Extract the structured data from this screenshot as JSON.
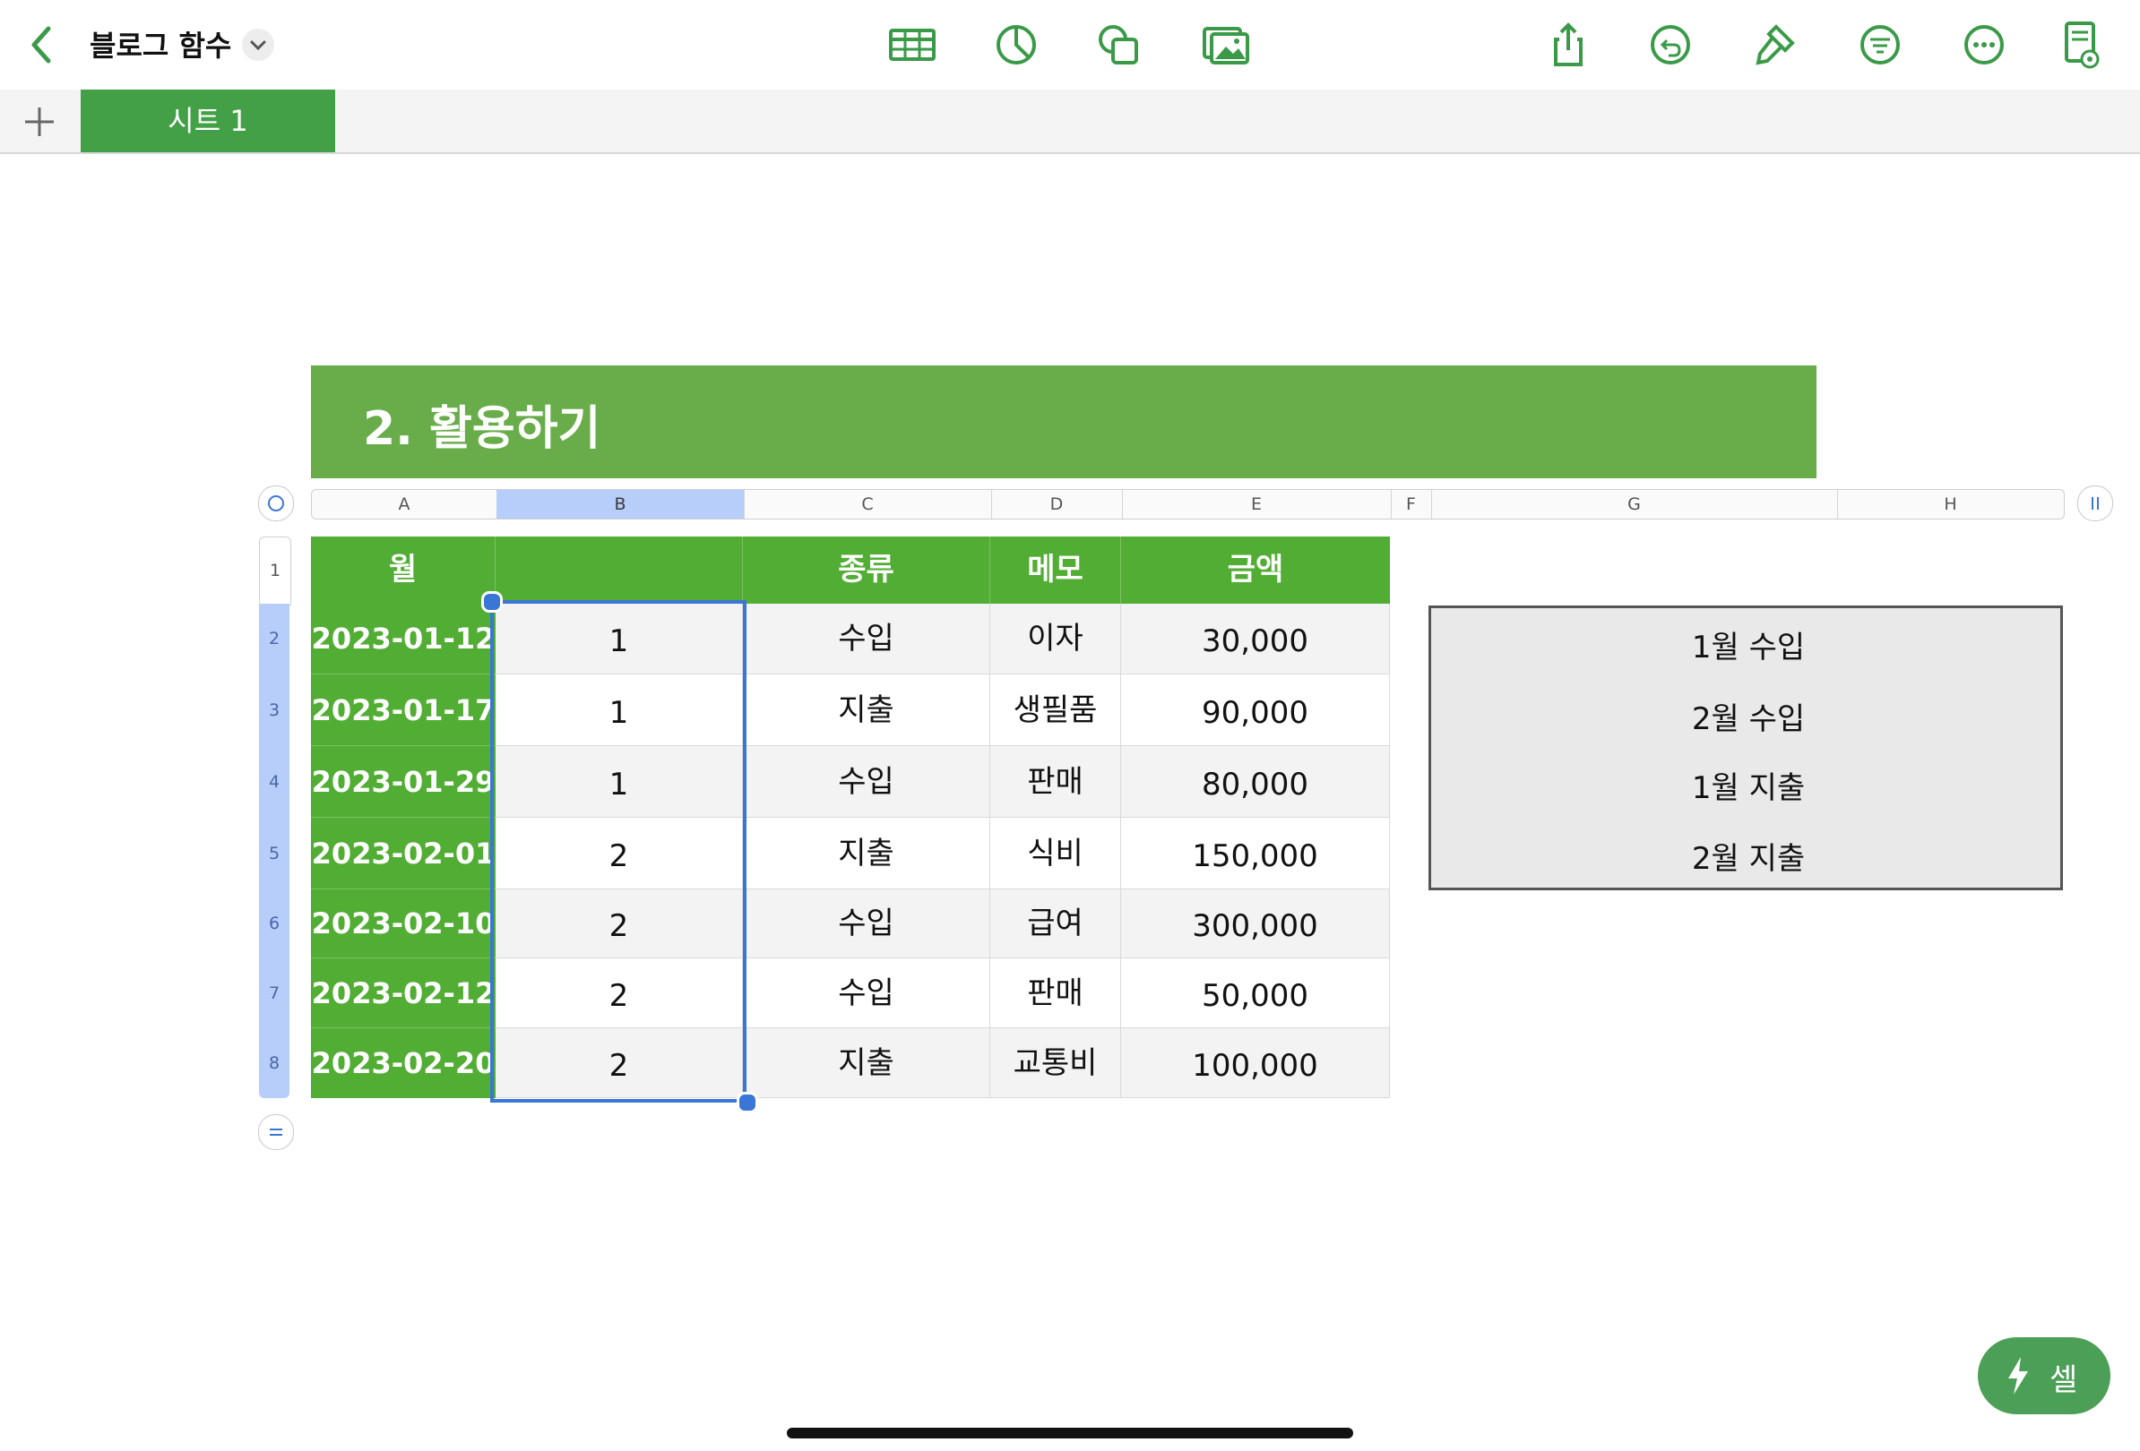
{
  "toolbar": {
    "title": "블로그 함수",
    "icons": [
      "back-chevron-icon",
      "table-icon",
      "chart-pie-icon",
      "shapes-icon",
      "media-icon",
      "share-icon",
      "undo-icon",
      "format-brush-icon",
      "filter-icon",
      "more-icon",
      "view-document-icon"
    ]
  },
  "tabs": {
    "sheet_name": "시트 1"
  },
  "title_block": {
    "text": "2. 활용하기"
  },
  "columns": [
    "A",
    "B",
    "C",
    "D",
    "E",
    "F",
    "G",
    "H"
  ],
  "rows": [
    "1",
    "2",
    "3",
    "4",
    "5",
    "6",
    "7",
    "8"
  ],
  "table": {
    "headers": [
      "월",
      "",
      "종류",
      "메모",
      "금액"
    ],
    "data": [
      [
        "2023-01-12",
        "1",
        "수입",
        "이자",
        "30,000"
      ],
      [
        "2023-01-17",
        "1",
        "지출",
        "생필품",
        "90,000"
      ],
      [
        "2023-01-29",
        "1",
        "수입",
        "판매",
        "80,000"
      ],
      [
        "2023-02-01",
        "2",
        "지출",
        "식비",
        "150,000"
      ],
      [
        "2023-02-10",
        "2",
        "수입",
        "급여",
        "300,000"
      ],
      [
        "2023-02-12",
        "2",
        "수입",
        "판매",
        "50,000"
      ],
      [
        "2023-02-20",
        "2",
        "지출",
        "교통비",
        "100,000"
      ]
    ]
  },
  "summary_items": [
    "1월 수입",
    "2월 수입",
    "1월 지출",
    "2월 지출"
  ],
  "cell_button": {
    "label": "셀"
  },
  "colors": {
    "accent": "#43a047",
    "header_green": "#52ad34",
    "selection": "#3a76d6"
  }
}
